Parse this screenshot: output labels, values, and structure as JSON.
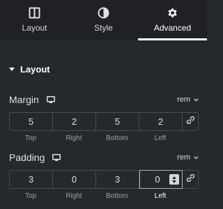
{
  "tabs": [
    {
      "label": "Layout",
      "icon": "layout-icon",
      "active": false
    },
    {
      "label": "Style",
      "icon": "half-circle-icon",
      "active": false
    },
    {
      "label": "Advanced",
      "icon": "gear-icon",
      "active": true
    }
  ],
  "section": {
    "title": "Layout"
  },
  "margin": {
    "label": "Margin",
    "unit": "rem",
    "values": {
      "top": "5",
      "right": "2",
      "bottom": "5",
      "left": "2"
    },
    "sublabels": {
      "top": "Top",
      "right": "Right",
      "bottom": "Bottom",
      "left": "Left"
    }
  },
  "padding": {
    "label": "Padding",
    "unit": "rem",
    "values": {
      "top": "3",
      "right": "0",
      "bottom": "3",
      "left": "0"
    },
    "sublabels": {
      "top": "Top",
      "right": "Right",
      "bottom": "Bottom",
      "left": "Left"
    }
  },
  "colors": {
    "panel": "#26292c",
    "tabs_bg": "#1f2124",
    "border": "#4a4e53",
    "text": "#e0e1e3",
    "muted": "#9da1a6"
  }
}
